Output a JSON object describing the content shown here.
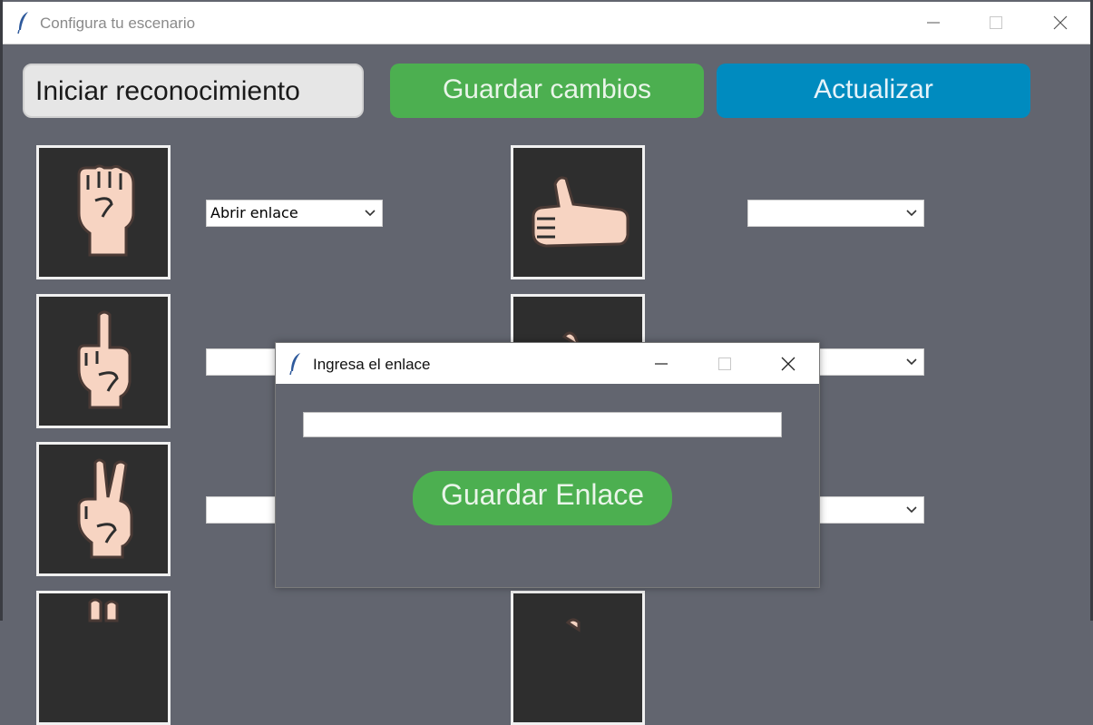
{
  "window": {
    "title": "Configura tu escenario"
  },
  "toolbar": {
    "start_label": "Iniciar reconocimiento",
    "save_label": "Guardar cambios",
    "refresh_label": "Actualizar"
  },
  "gestures": {
    "left_selects": [
      "Abrir enlace",
      "",
      ""
    ],
    "right_selects": [
      "",
      "",
      ""
    ]
  },
  "dialog": {
    "title": "Ingresa el enlace",
    "input_value": "",
    "save_link_label": "Guardar Enlace"
  },
  "colors": {
    "background": "#62656f",
    "green": "#4caf50",
    "blue": "#008bbf",
    "tile": "#2e2e2e",
    "skin": "#f7d4c2"
  },
  "icons": {
    "gesture_1": "fist-icon",
    "gesture_2": "index-finger-up-icon",
    "gesture_3": "peace-sign-icon",
    "gesture_right_1": "thumbs-up-icon"
  }
}
